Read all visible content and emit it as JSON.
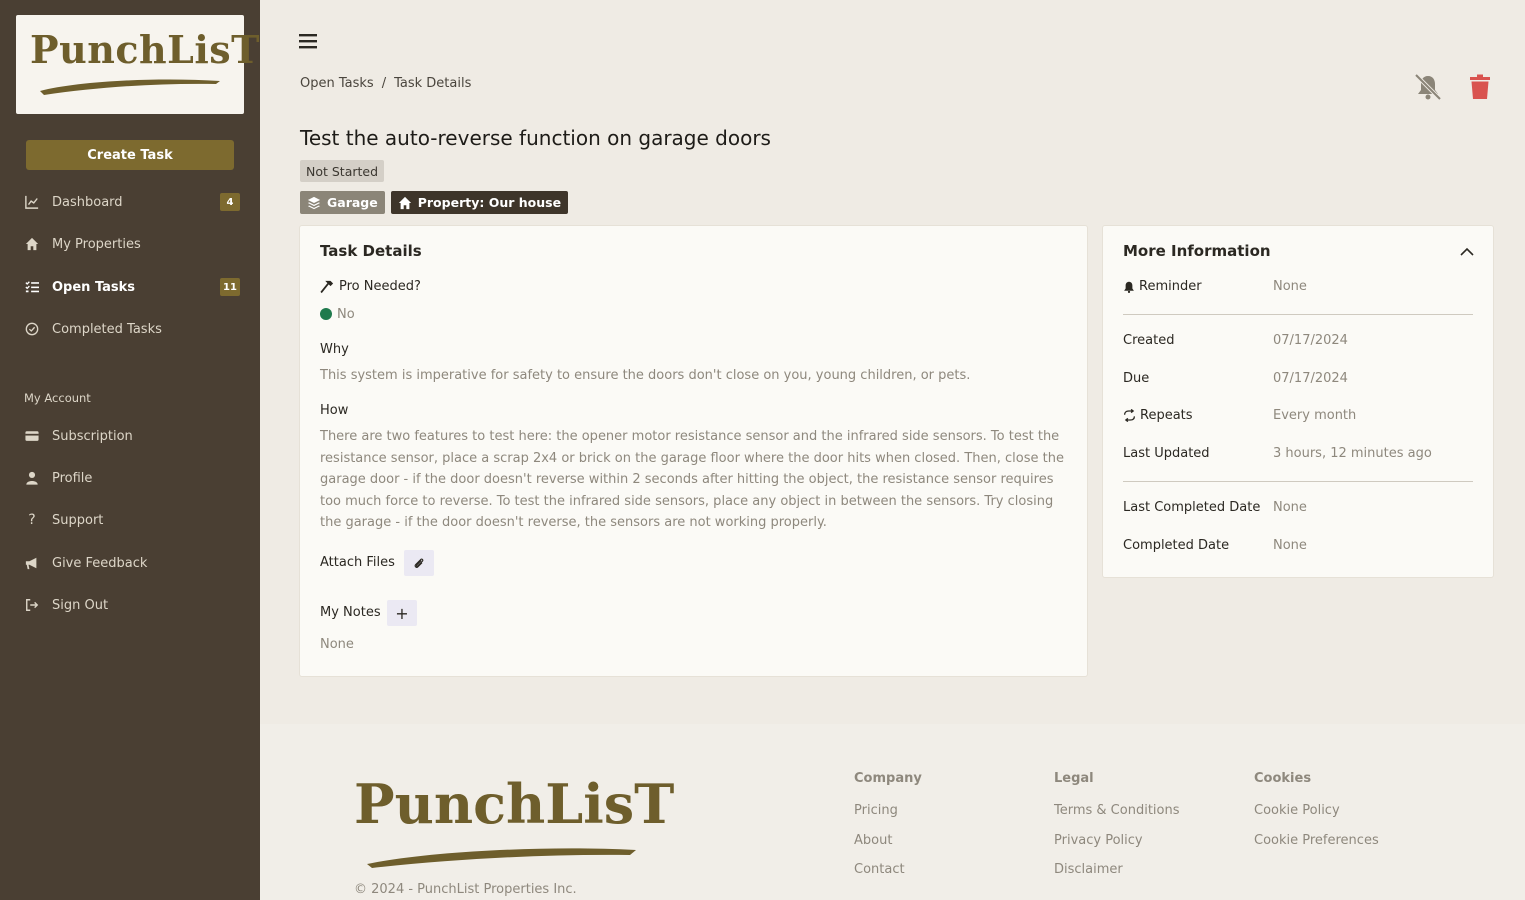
{
  "sidebar": {
    "logo_text": "PunchLisT",
    "create_task_label": "Create Task",
    "items": [
      {
        "label": "Dashboard",
        "icon": "chart-line-icon",
        "badge": "4"
      },
      {
        "label": "My Properties",
        "icon": "home-icon"
      },
      {
        "label": "Open Tasks",
        "icon": "list-check-icon",
        "badge": "11"
      },
      {
        "label": "Completed Tasks",
        "icon": "circle-check-icon"
      }
    ],
    "account_label": "My Account",
    "account_items": [
      {
        "label": "Subscription",
        "icon": "credit-card-icon"
      },
      {
        "label": "Profile",
        "icon": "user-icon"
      },
      {
        "label": "Support",
        "icon": "question-icon"
      },
      {
        "label": "Give Feedback",
        "icon": "megaphone-icon"
      },
      {
        "label": "Sign Out",
        "icon": "sign-out-icon"
      }
    ]
  },
  "breadcrumb": {
    "parent": "Open Tasks",
    "separator": "/",
    "current": "Task Details"
  },
  "task": {
    "title": "Test the auto-reverse function on garage doors",
    "status": "Not Started",
    "category_tag": "Garage",
    "property_tag": "Property: Our house"
  },
  "details": {
    "card_title": "Task Details",
    "pro_needed_label": "Pro Needed?",
    "pro_needed_value": "No",
    "why_label": "Why",
    "why_text": "This system is imperative for safety to ensure the doors don't close on you, young children, or pets.",
    "how_label": "How",
    "how_text": "There are two features to test here: the opener motor resistance sensor and the infrared side sensors. To test the resistance sensor, place a scrap 2x4 or brick on the garage floor where the door hits when closed. Then, close the garage door - if the door doesn't reverse within 2 seconds after hitting the object, the resistance sensor requires too much force to reverse. To test the infrared side sensors, place any object in between the sensors. Try closing the garage - if the door doesn't reverse, the sensors are not working properly.",
    "attach_label": "Attach Files",
    "notes_label": "My Notes",
    "notes_add": "+",
    "notes_value": "None"
  },
  "more_info": {
    "title": "More Information",
    "reminder_label": "Reminder",
    "reminder_value": "None",
    "created_label": "Created",
    "created_value": "07/17/2024",
    "due_label": "Due",
    "due_value": "07/17/2024",
    "repeats_label": "Repeats",
    "repeats_value": "Every month",
    "updated_label": "Last Updated",
    "updated_value": "3 hours, 12 minutes ago",
    "last_completed_label": "Last Completed Date",
    "last_completed_value": "None",
    "completed_label": "Completed Date",
    "completed_value": "None"
  },
  "footer": {
    "logo_text": "PunchLisT",
    "copyright": "© 2024 - PunchList Properties Inc.",
    "columns": [
      {
        "heading": "Company",
        "links": [
          "Pricing",
          "About",
          "Contact"
        ]
      },
      {
        "heading": "Legal",
        "links": [
          "Terms & Conditions",
          "Privacy Policy",
          "Disclaimer"
        ]
      },
      {
        "heading": "Cookies",
        "links": [
          "Cookie Policy",
          "Cookie Preferences"
        ]
      }
    ]
  },
  "colors": {
    "sidebar_bg": "#4a3f33",
    "accent": "#7d6a2f",
    "delete_red": "#d9534f",
    "status_green": "#1f7a4d"
  }
}
